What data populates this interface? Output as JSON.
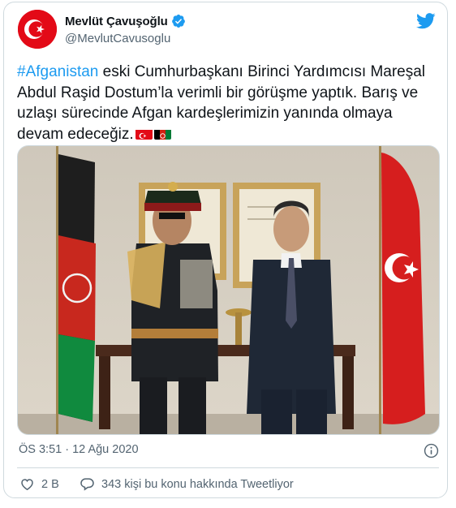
{
  "author": {
    "display_name": "Mevlüt Çavuşoğlu",
    "handle": "@MevlutCavusoglu",
    "verified": true,
    "avatar_icon": "turkish-flag-crescent-avatar"
  },
  "tweet": {
    "hashtag": "#Afganistan",
    "text": " eski Cumhurbaşkanı Birinci Yardımcısı Mareşal Abdul Raşid Dostum’la verimli bir görüşme yaptık. Barış ve uzlaşı sürecinde Afgan kardeşlerimizin yanında olmaya devam edeceğiz.",
    "emoji_flags": [
      "turkey-flag-emoji",
      "afghanistan-flag-emoji"
    ],
    "media_description_icon": "photo"
  },
  "meta": {
    "timestamp": "ÖS 3:51 · 12 Ağu 2020"
  },
  "actions": {
    "like_count": "2 B",
    "reply_label": "343 kişi bu konu hakkında Tweetliyor"
  },
  "colors": {
    "accent": "#1d9bf0",
    "text_primary": "#0f1419",
    "text_secondary": "#536471",
    "border": "#cfd9de",
    "turkey_red": "#e30a17"
  }
}
